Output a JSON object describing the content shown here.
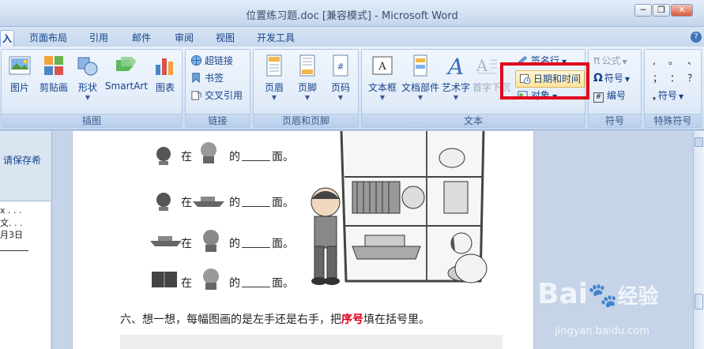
{
  "window": {
    "title": "位置练习题.doc [兼容模式] - Microsoft Word",
    "controls": {
      "minimize": "─",
      "restore": "❐",
      "close": "✕"
    }
  },
  "tabs": [
    {
      "label": "入",
      "active": true
    },
    {
      "label": "页面布局"
    },
    {
      "label": "引用"
    },
    {
      "label": "邮件"
    },
    {
      "label": "审阅"
    },
    {
      "label": "视图"
    },
    {
      "label": "开发工具"
    }
  ],
  "ribbon": {
    "illustrations": {
      "label": "插图",
      "buttons": [
        "图片",
        "剪贴画",
        "形状",
        "SmartArt",
        "图表"
      ]
    },
    "links": {
      "label": "链接",
      "buttons": [
        "超链接",
        "书签",
        "交叉引用"
      ]
    },
    "header_footer": {
      "label": "页眉和页脚",
      "buttons": [
        "页眉",
        "页脚",
        "页码"
      ]
    },
    "text": {
      "label": "文本",
      "buttons": [
        "文本框",
        "文档部件",
        "艺术字",
        "首字下沉"
      ],
      "small": [
        "签名行",
        "日期和时间",
        "对象"
      ]
    },
    "symbols": {
      "label": "符号",
      "buttons": [
        "公式",
        "符号",
        "编号"
      ]
    },
    "special": {
      "label": "特殊符号",
      "buttons": [
        ",",
        "。",
        "、",
        "；",
        "：",
        "？",
        "符号"
      ]
    }
  },
  "left_pane": {
    "text": "请保存希",
    "card": [
      "x  . . .",
      "文. . .",
      "月3日"
    ]
  },
  "document": {
    "rows": [
      {
        "a": "在",
        "b": "的",
        "c": "面。"
      },
      {
        "a": "在",
        "b": "的",
        "c": "面。"
      },
      {
        "a": "在",
        "b": "的",
        "c": "面。"
      },
      {
        "a": "在",
        "b": "的",
        "c": "面。"
      }
    ],
    "question": {
      "prefix": "六、想一想，每幅图画的是左手还是右手，把",
      "highlight": "序号",
      "suffix": "填在括号里。"
    },
    "colors": {
      "highlight": "#e0001b"
    }
  },
  "watermark": {
    "brand": "Bai",
    "brand2": "经验",
    "url": "jingyan.baidu.com"
  }
}
